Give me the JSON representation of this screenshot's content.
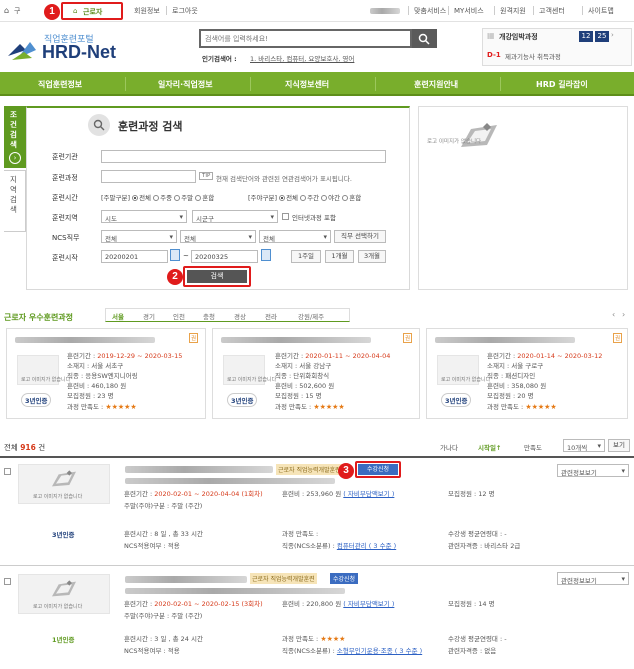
{
  "topbar": {
    "home_prefix": "구",
    "worker_tab": "근로자",
    "links": [
      "회원정보",
      "로그아웃"
    ],
    "right_links": [
      "맞춤서비스",
      "MY서비스",
      "원격지원",
      "고객센터",
      "사이트맵"
    ]
  },
  "logo": {
    "subtitle": "직업훈련포털",
    "title": "HRD-Net"
  },
  "search": {
    "placeholder": "검색어를 입력하세요!",
    "popular_label": "인기검색어 :",
    "popular_terms": "1. 바리스타, 컴퓨터, 요양보호사, 영어"
  },
  "calendar": {
    "title": "개강임박과정",
    "month": "12",
    "day": "25",
    "dday": "D-1",
    "course": "제과기능사 취득과정"
  },
  "nav": [
    "직업훈련정보",
    "일자리·직업정보",
    "지식정보센터",
    "훈련지원안내",
    "HRD 길라잡이"
  ],
  "side_tabs": {
    "condition": "조건검색",
    "region": "지역검색"
  },
  "form": {
    "title": "훈련과정 검색",
    "institution_label": "훈련기관",
    "course_label": "훈련과정",
    "tip": "TIP",
    "tip_text": "현재 검색단어와 관련된 연관검색어가 표시됩니다.",
    "time_label": "훈련시간",
    "weekday_label": "[주말구분]",
    "weekday_options": [
      "전체",
      "주중",
      "주말",
      "혼합"
    ],
    "daynight_label": "[주야구분]",
    "daynight_options": [
      "전체",
      "주간",
      "야간",
      "혼합"
    ],
    "region_label": "훈련지역",
    "sido": "시도",
    "sigungu": "시군구",
    "internet_chk": "인터넷과정 포함",
    "ncs_label": "NCS직무",
    "ncs1": "전체",
    "ncs2": "전체",
    "ncs3": "전체",
    "job_btn": "직무 선택하기",
    "start_label": "훈련시작",
    "date_from": "20200201",
    "date_tilde": "~",
    "date_to": "20200325",
    "period_btns": [
      "1주일",
      "1개월",
      "3개월"
    ],
    "search_btn": "검색"
  },
  "right_panel": {
    "noimage": "로고 이미지가 없습니다"
  },
  "annotations": [
    "1",
    "2",
    "3"
  ],
  "excellent": {
    "title": "근로자 우수훈련과정",
    "regions": [
      "서울",
      "경기",
      "인천",
      "충청",
      "경상",
      "전라",
      "강원/제주"
    ],
    "cards": [
      {
        "badge": "권",
        "period_label": "훈련기간 :",
        "period": "2019-12-29 ~ 2020-03-15",
        "loc": "소재지 : 서울 서초구",
        "job": "직종 : 응용SW엔지니어링",
        "fee": "훈련비 : 460,180 원",
        "count": "모집정원 : 23 명",
        "satisfy": "과정 만족도 :",
        "stars": "★★★★★",
        "cert": "3년인증",
        "img_cap": "로고 이미지가 없습니다"
      },
      {
        "badge": "권",
        "period_label": "훈련기간 :",
        "period": "2020-01-11 ~ 2020-04-04",
        "loc": "소재지 : 서울 강남구",
        "job": "직종 : 단위화회창식",
        "fee": "훈련비 : 502,600 원",
        "count": "모집정원 : 15 명",
        "satisfy": "과정 만족도 :",
        "stars": "★★★★★",
        "cert": "3년인증",
        "img_cap": "로고 이미지가 없습니다"
      },
      {
        "badge": "권",
        "period_label": "훈련기간 :",
        "period": "2020-01-14 ~ 2020-03-12",
        "loc": "소재지 : 서울 구로구",
        "job": "직종 : 패션디자인",
        "fee": "훈련비 : 358,080 원",
        "count": "모집정원 : 20 명",
        "satisfy": "과정 만족도 :",
        "stars": "★★★★★",
        "cert": "3년인증",
        "img_cap": "로고 이미지가 없습니다"
      }
    ]
  },
  "results": {
    "total_prefix": "전체",
    "total": "916",
    "total_suffix": "건",
    "sort": [
      "가나다",
      "시작일↑",
      "만족도"
    ],
    "per_page": "10개씩",
    "view_btn": "보기",
    "items": [
      {
        "tag": "근로자 직업능력개발훈련",
        "apply": "수강신청",
        "period_label": "훈련기간 :",
        "period": "2020-02-01 ~ 2020-04-04 (1회차)",
        "daytype": "주말(주야)구분 : 주말 (주간)",
        "fee_label": "훈련비 :",
        "fee": "253,960 원",
        "fee_link": "( 자비부담액보기 )",
        "count": "모집정원 : 12 명",
        "hours": "훈련시간 : 8 일 , 총 33 시간",
        "ncs": "NCS적용여부 : 적용",
        "satisfy": "과정 만족도 :",
        "job": "직종(NCS소분류) :",
        "job_link": "컴퓨터관리 ( 3 수준 )",
        "avg": "수강생 평균연령대 : -",
        "license": "관련자격증 : 바리스타 2급",
        "cert": "3년인증",
        "related": "관련정보보기",
        "stars": "",
        "img_cap": "로고 이미지가 없습니다"
      },
      {
        "tag": "근로자 직업능력개발훈련",
        "apply": "수강신청",
        "period_label": "훈련기간 :",
        "period": "2020-02-01 ~ 2020-02-15 (3회차)",
        "daytype": "주말(주야)구분 : 주말 (주간)",
        "fee_label": "훈련비 :",
        "fee": "220,800 원",
        "fee_link": "( 자비부담액보기 )",
        "count": "모집정원 : 14 명",
        "hours": "훈련시간 : 3 일 , 총 24 시간",
        "ncs": "NCS적용여부 : 적용",
        "satisfy": "과정 만족도 :",
        "job": "직종(NCS소분류) :",
        "job_link": "소형무인기운용·조종 ( 3 수준 )",
        "avg": "수강생 평균연령대 : -",
        "license": "관련자격증 : 없음",
        "cert": "1년인증",
        "related": "관련정보보기",
        "stars": "★★★★",
        "img_cap": "로고 이미지가 없습니다"
      }
    ]
  },
  "colors": {
    "accent": "#79ae2c",
    "red": "#e01b1b",
    "navy": "#1f3f7a"
  }
}
